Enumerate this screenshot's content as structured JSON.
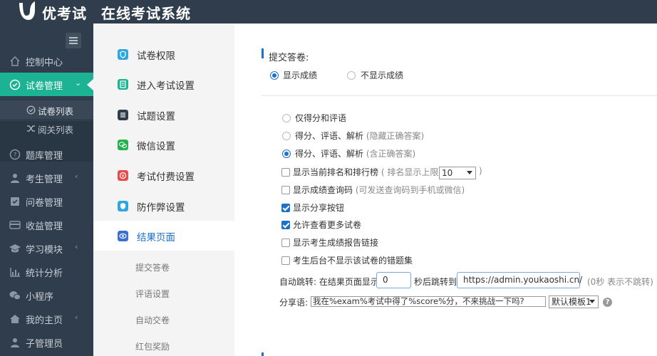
{
  "header": {
    "brand": "优考试",
    "system_name": "在线考试系统"
  },
  "sidebar": {
    "items": [
      {
        "label": "控制中心",
        "icon": "home-icon"
      },
      {
        "label": "试卷管理",
        "icon": "check-circle-icon",
        "active": true
      },
      {
        "label": "题库管理",
        "icon": "question-circle-icon"
      },
      {
        "label": "考生管理",
        "icon": "user-icon"
      },
      {
        "label": "问卷管理",
        "icon": "checkbox-icon"
      },
      {
        "label": "收益管理",
        "icon": "credit-card-icon"
      },
      {
        "label": "学习模块",
        "icon": "graduation-cap-icon"
      },
      {
        "label": "统计分析",
        "icon": "bar-chart-icon"
      },
      {
        "label": "小程序",
        "icon": "wechat-icon"
      },
      {
        "label": "我的主页",
        "icon": "home-icon"
      },
      {
        "label": "子管理员",
        "icon": "user-icon"
      }
    ],
    "sub_items": [
      {
        "label": "试卷列表",
        "icon": "check-circle-icon"
      },
      {
        "label": "阅关列表",
        "icon": "shuffle-icon"
      }
    ]
  },
  "settings_menu": {
    "items": [
      {
        "label": "试卷权限",
        "icon": "shield-icon",
        "color": "#2ea7e0"
      },
      {
        "label": "进入考试设置",
        "icon": "document-icon",
        "color": "#1bb394"
      },
      {
        "label": "试题设置",
        "icon": "list-icon",
        "color": "#2f3d4c"
      },
      {
        "label": "微信设置",
        "icon": "wechat-icon",
        "color": "#22b14c"
      },
      {
        "label": "考试付费设置",
        "icon": "money-icon",
        "color": "#e94b4b"
      },
      {
        "label": "防作弊设置",
        "icon": "shield-check-icon",
        "color": "#2ea7e0"
      },
      {
        "label": "结果页面",
        "icon": "eye-icon",
        "color": "#3b6fd0",
        "selected": true
      }
    ],
    "sub_items": [
      "提交答卷",
      "评语设置",
      "自动交卷",
      "红包奖励"
    ]
  },
  "content": {
    "section_title": "提交答卷:",
    "score_display": {
      "show": "显示成绩",
      "hide": "不显示成绩"
    },
    "result_options": [
      {
        "label": "仅得分和评语",
        "hint": ""
      },
      {
        "label": "得分、评语、解析",
        "hint": "(隐藏正确答案)"
      },
      {
        "label": "得分、评语、解析",
        "hint": "(含正确答案)"
      }
    ],
    "ranking": {
      "label": "显示当前排名和排行榜",
      "hint_prefix": "( 排名显示上限",
      "value": "10",
      "hint_suffix": ")"
    },
    "query_code": {
      "label": "显示成绩查询码",
      "hint": "(可发送查询码到手机或微信)"
    },
    "checkboxes": [
      {
        "label": "显示分享按钮",
        "checked": true
      },
      {
        "label": "允许查看更多试卷",
        "checked": true
      },
      {
        "label": "显示考生成绩报告链接",
        "checked": false
      },
      {
        "label": "考生后台不显示该试卷的错题集",
        "checked": false
      }
    ],
    "redirect": {
      "prefix": "自动跳转: 在结果页面显示",
      "seconds": "0",
      "middle": "秒后跳转到",
      "url": "https://admin.youkaoshi.cn/",
      "hint": "(0秒 表示不跳转)"
    },
    "share": {
      "label": "分享语:",
      "text": "我在%exam%考试中得了%score%分，不来挑战一下吗?",
      "template": "默认模板1",
      "help": "?"
    }
  }
}
